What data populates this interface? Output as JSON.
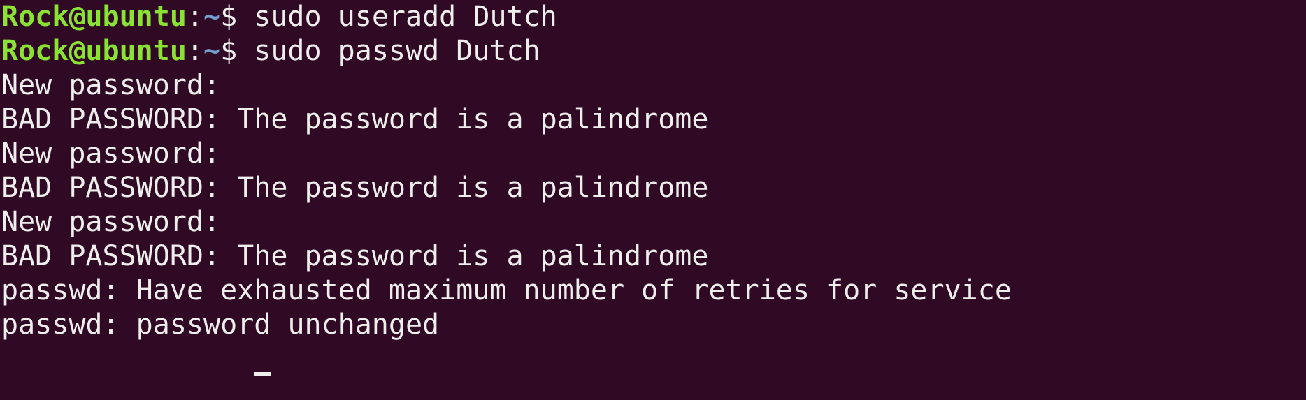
{
  "terminal": {
    "prompt_user": "Rock@ubuntu",
    "prompt_sep": ":",
    "prompt_path": "~",
    "prompt_symbol": "$ ",
    "lines": [
      {
        "type": "command",
        "command": "sudo useradd Dutch"
      },
      {
        "type": "command",
        "command": "sudo passwd Dutch"
      },
      {
        "type": "output",
        "text": "New password:"
      },
      {
        "type": "output",
        "text": "BAD PASSWORD: The password is a palindrome"
      },
      {
        "type": "output",
        "text": "New password:"
      },
      {
        "type": "output",
        "text": "BAD PASSWORD: The password is a palindrome"
      },
      {
        "type": "output",
        "text": "New password:"
      },
      {
        "type": "output",
        "text": "BAD PASSWORD: The password is a palindrome"
      },
      {
        "type": "output",
        "text": "passwd: Have exhausted maximum number of retries for service"
      },
      {
        "type": "output",
        "text": "passwd: password unchanged"
      }
    ],
    "colors": {
      "background": "#300a24",
      "user": "#8ae234",
      "path": "#729fcf",
      "text": "#eeeeec"
    }
  }
}
